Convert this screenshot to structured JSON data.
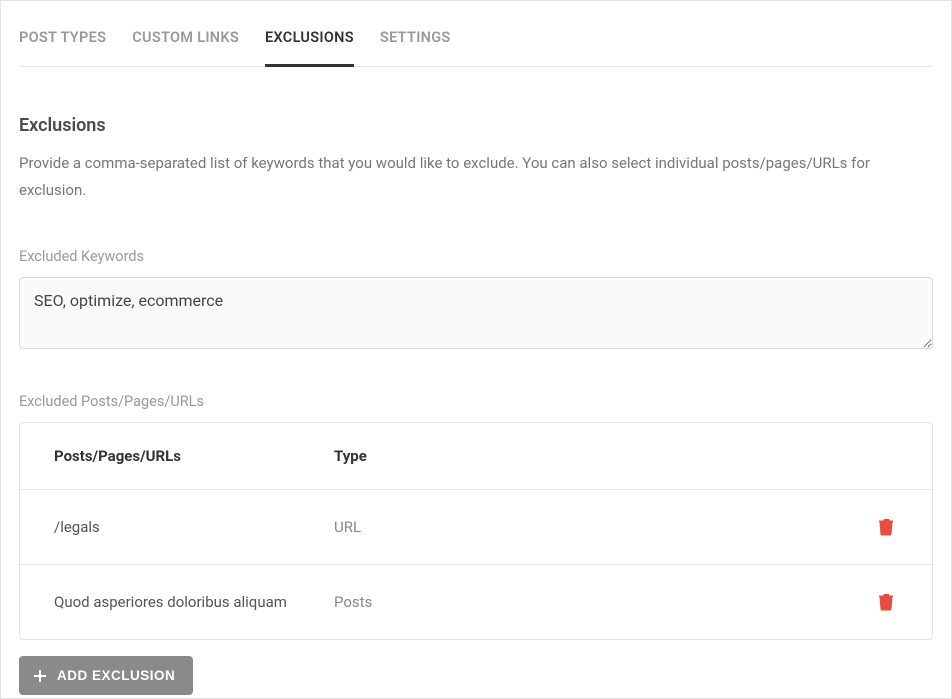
{
  "tabs": {
    "post_types": "POST TYPES",
    "custom_links": "CUSTOM LINKS",
    "exclusions": "EXCLUSIONS",
    "settings": "SETTINGS"
  },
  "section": {
    "title": "Exclusions",
    "description": "Provide a comma-separated list of keywords that you would like to exclude. You can also select individual posts/pages/URLs for exclusion."
  },
  "excluded_keywords": {
    "label": "Excluded Keywords",
    "value": "SEO, optimize, ecommerce"
  },
  "excluded_items": {
    "label": "Excluded Posts/Pages/URLs",
    "columns": {
      "name": "Posts/Pages/URLs",
      "type": "Type"
    },
    "rows": [
      {
        "name": "/legals",
        "type": "URL"
      },
      {
        "name": "Quod asperiores doloribus aliquam",
        "type": "Posts"
      }
    ]
  },
  "add_button": "ADD EXCLUSION"
}
